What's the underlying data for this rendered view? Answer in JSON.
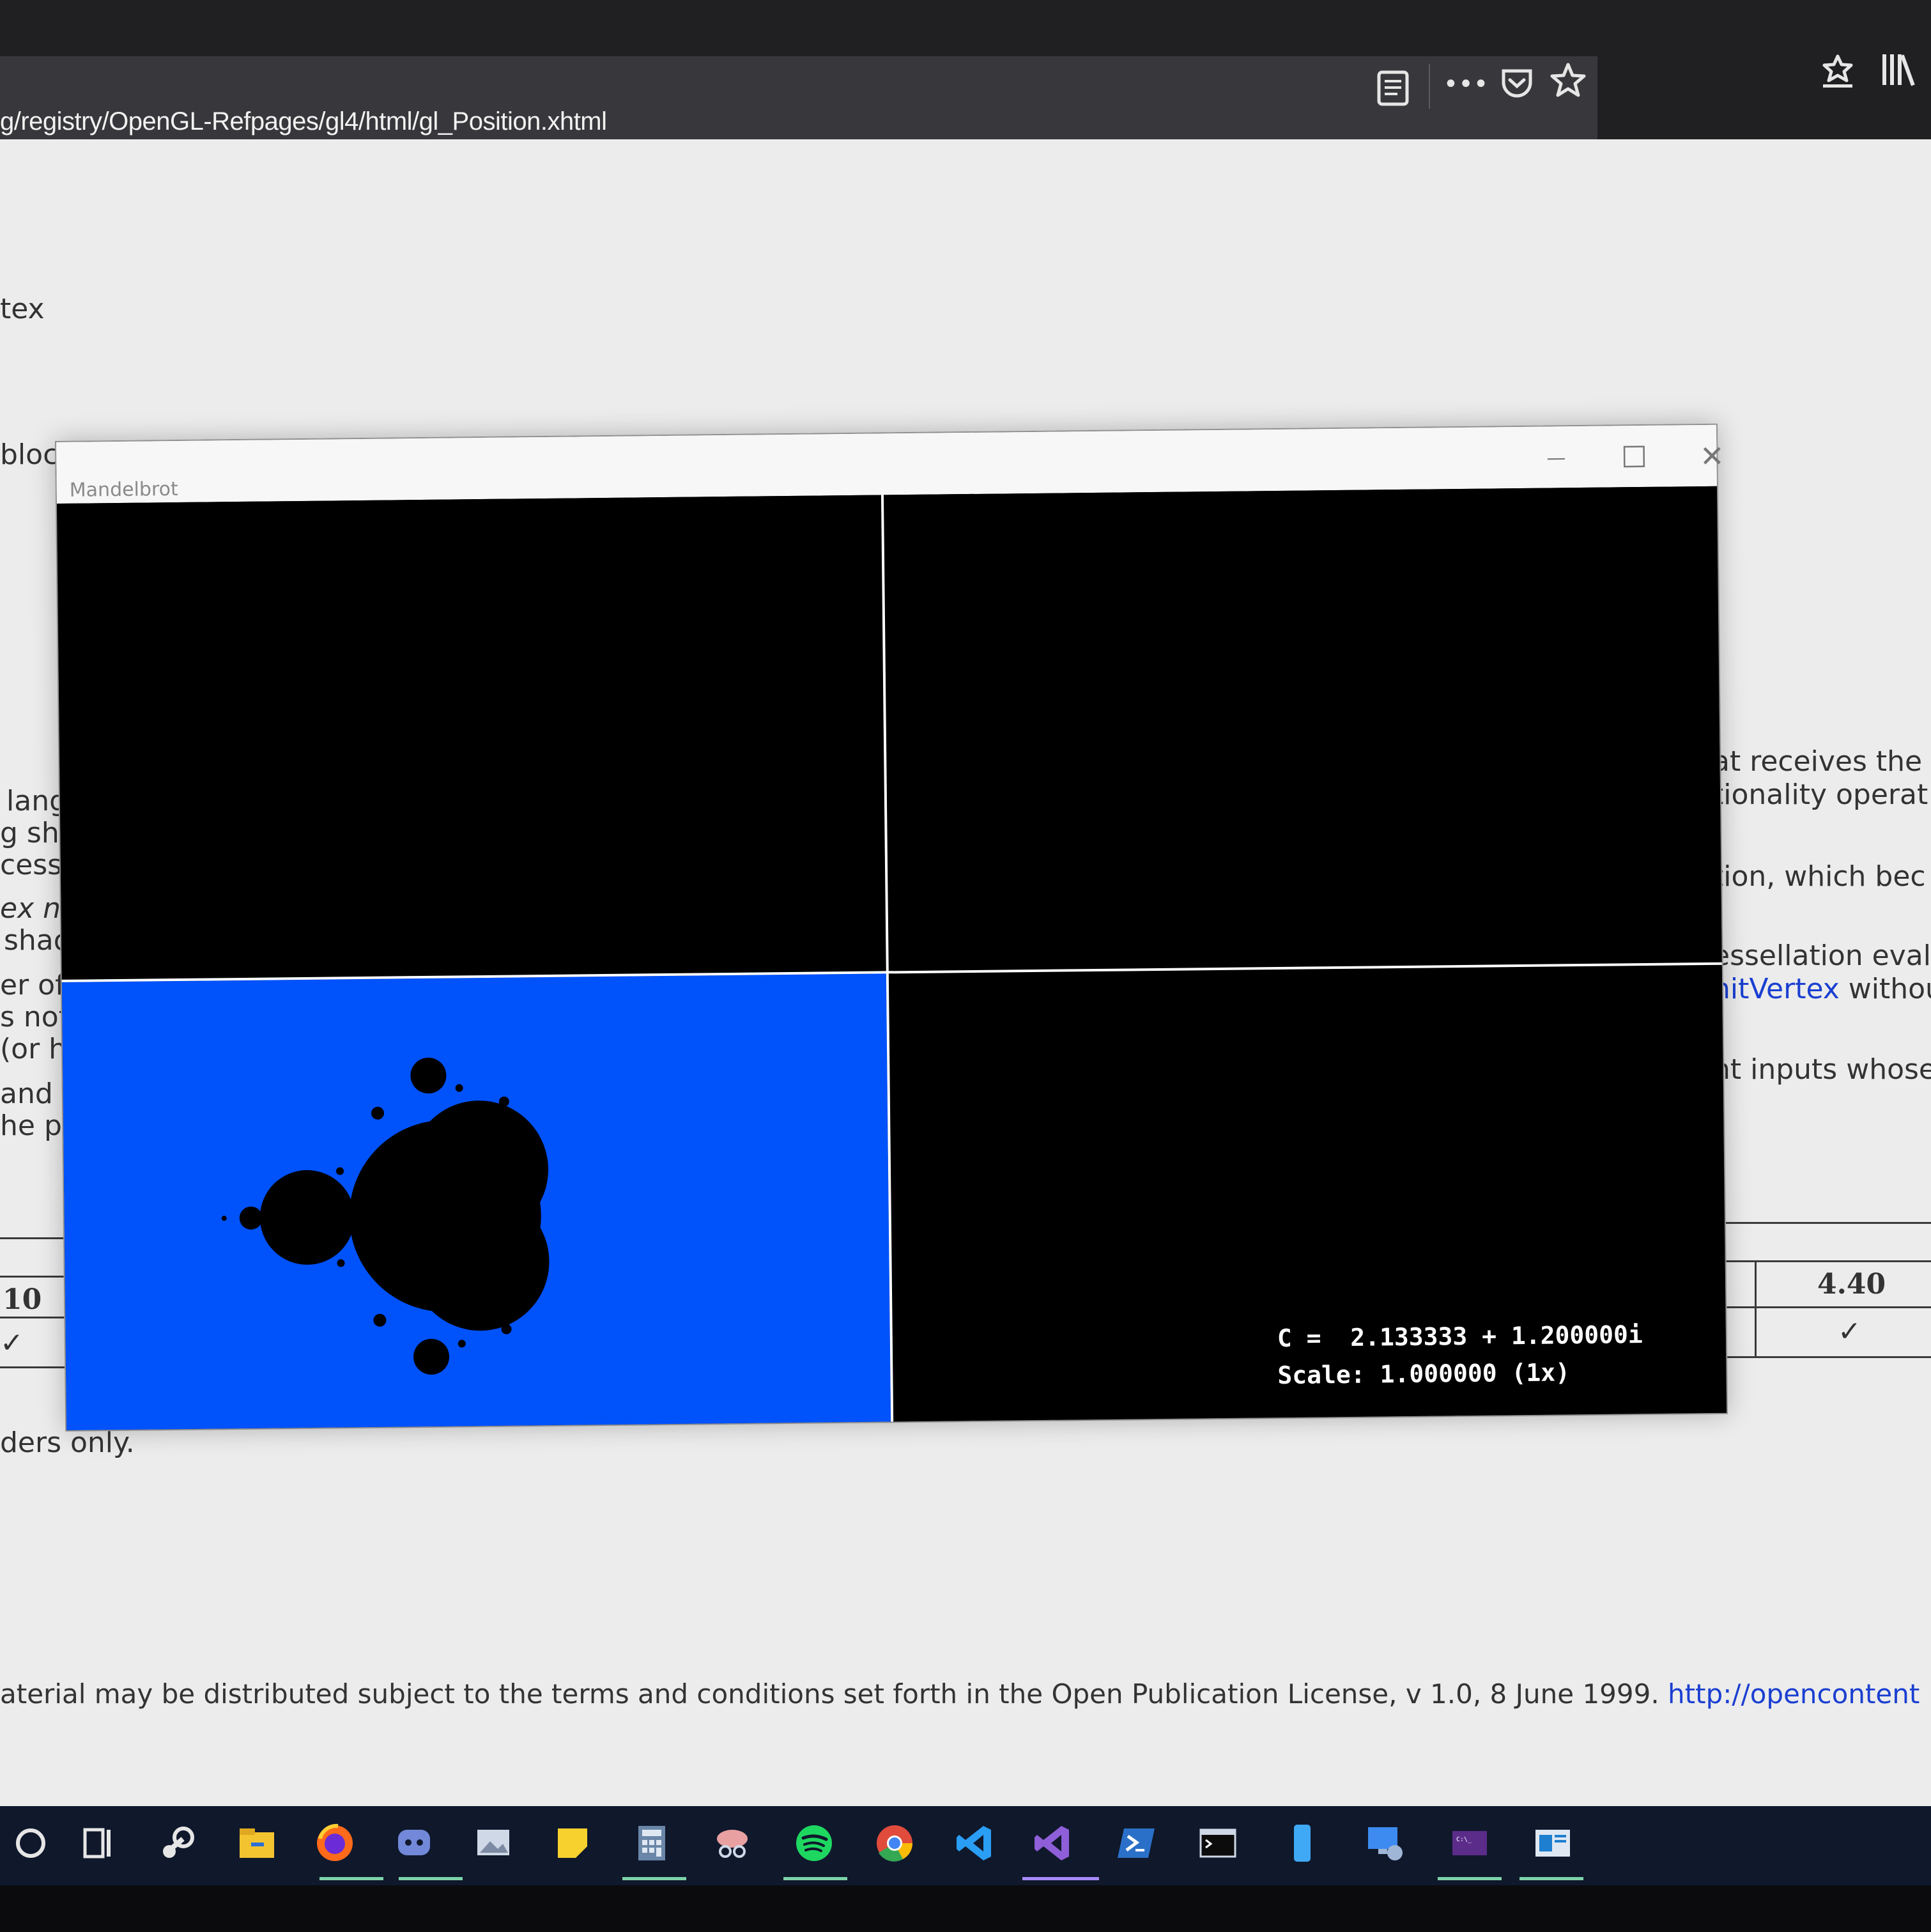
{
  "browser": {
    "url": "g/registry/OpenGL-Refpages/gl4/html/gl_Position.xhtml",
    "icons": [
      "reader-view-icon",
      "more-icon",
      "pocket-icon",
      "bookmark-star-icon",
      "bookmark-manage-icon",
      "library-icon"
    ],
    "more_glyph": "•••"
  },
  "page": {
    "heading_fragment_1": "tex",
    "heading_fragment_2": "block:",
    "left_lines": [
      "langu",
      "g sha",
      "cessir",
      "ex nar",
      "shade",
      "er of th",
      "s not w",
      "(or ha",
      "and ge",
      "he prev"
    ],
    "right_lines": [
      "at receives the",
      "tionality operat",
      "tion, which bec",
      "essellation evalu",
      "nitVertex withou",
      "nt inputs whose"
    ],
    "right_link": "nitVertex",
    "right_link_suffix": " withou",
    "table_left_value": "10",
    "table_left_check": "✓",
    "table_right_value": "4.40",
    "table_right_check": "✓",
    "shaders_note": "ders only.",
    "license_text": "aterial may be distributed subject to the terms and conditions set forth in the Open Publication License, v 1.0, 8 June 1999.",
    "license_link": "http://opencontent"
  },
  "window": {
    "title": "Mandelbrot",
    "minimize_glyph": "—",
    "maximize_glyph": "☐",
    "close_glyph": "✕",
    "colors": {
      "set_background": "#0052fb",
      "set_fill": "#000000",
      "divider": "#ffffff"
    },
    "readout_c": "C =  2.133333 + 1.200000i",
    "readout_scale": "Scale: 1.000000 (1x)"
  },
  "taskbar": {
    "icons": [
      "cortana-icon",
      "task-view-icon",
      "steam-icon",
      "file-explorer-icon",
      "firefox-icon",
      "discord-icon",
      "photos-icon",
      "sticky-notes-icon",
      "calculator-icon",
      "snipping-icon",
      "spotify-icon",
      "chrome-icon",
      "vscode-icon",
      "visual-studio-icon",
      "powershell-icon",
      "terminal-icon",
      "phone-icon",
      "remote-desktop-icon",
      "command-prompt-icon",
      "mandelbrot-app-icon"
    ]
  }
}
